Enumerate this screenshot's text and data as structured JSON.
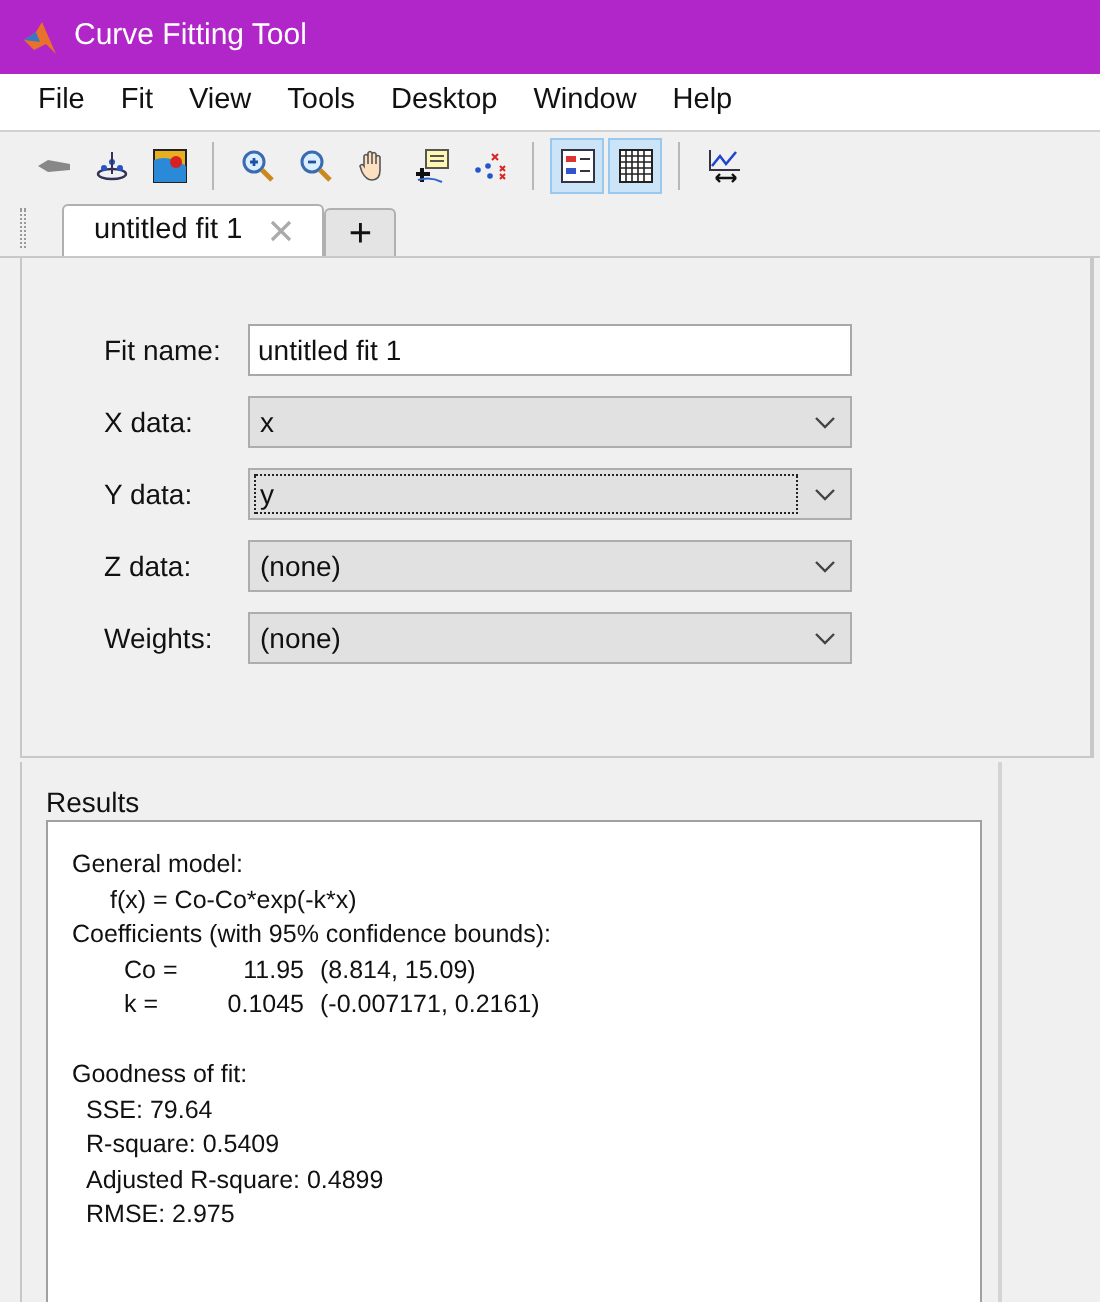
{
  "window": {
    "title": "Curve Fitting Tool"
  },
  "menu": [
    "File",
    "Fit",
    "View",
    "Tools",
    "Desktop",
    "Window",
    "Help"
  ],
  "toolbar": {
    "groups": [
      [
        {
          "kind": "arrow",
          "selected": false
        },
        {
          "kind": "data",
          "selected": false
        },
        {
          "kind": "surface",
          "selected": false
        }
      ],
      [
        {
          "kind": "zoom-in",
          "selected": false
        },
        {
          "kind": "zoom-out",
          "selected": false
        },
        {
          "kind": "pan",
          "selected": false
        },
        {
          "kind": "data-cursor",
          "selected": false
        },
        {
          "kind": "exclude",
          "selected": false
        }
      ],
      [
        {
          "kind": "legend",
          "selected": true
        },
        {
          "kind": "grid",
          "selected": true
        }
      ],
      [
        {
          "kind": "axes-limits",
          "selected": false
        }
      ]
    ]
  },
  "tabs": [
    {
      "label": "untitled fit 1",
      "selected": true
    }
  ],
  "new_tab": "+",
  "form": {
    "fit_name": {
      "label": "Fit name:",
      "value": "untitled fit 1"
    },
    "selects": [
      {
        "label": "X data:",
        "value": "x",
        "focused": false
      },
      {
        "label": "Y data:",
        "value": "y",
        "focused": true
      },
      {
        "label": "Z data:",
        "value": "(none)",
        "focused": false
      },
      {
        "label": "Weights:",
        "value": "(none)",
        "focused": false
      }
    ]
  },
  "results": {
    "title": "Results",
    "blocks": [
      {
        "kind": "text",
        "heading": "General model:",
        "lines": [
          "f(x) = Co-Co*exp(-k*x)"
        ]
      },
      {
        "kind": "coefficients",
        "heading": "Coefficients (with 95% confidence bounds):",
        "rows": [
          {
            "name": "Co =",
            "value": "11.95",
            "bounds": "(8.814, 15.09)"
          },
          {
            "name": "k =",
            "value": "0.1045",
            "bounds": "(-0.007171, 0.2161)"
          }
        ]
      },
      {
        "kind": "stats",
        "heading": "Goodness of fit:",
        "lines": [
          "SSE: 79.64",
          "R-square: 0.5409",
          "Adjusted R-square: 0.4899",
          "RMSE: 2.975"
        ]
      }
    ]
  }
}
